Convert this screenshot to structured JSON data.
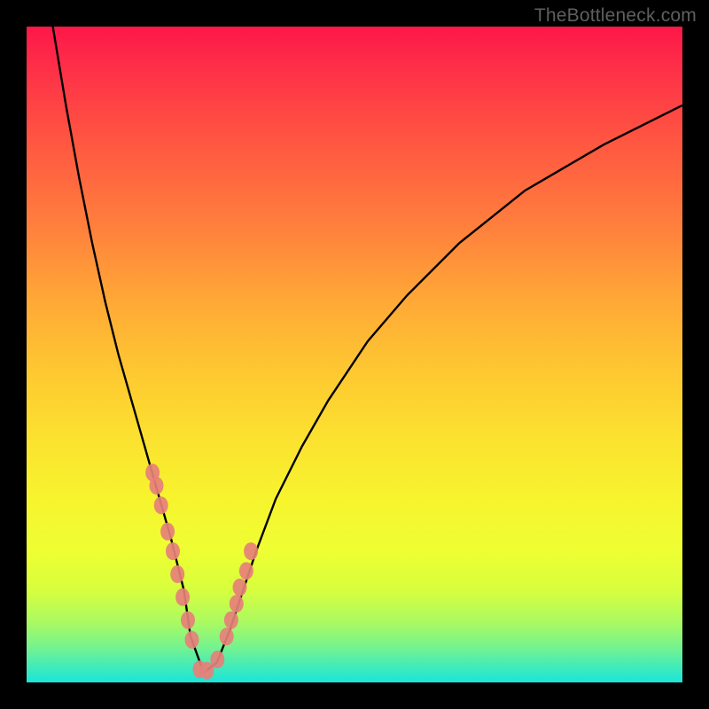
{
  "watermark": "TheBottleneck.com",
  "chart_data": {
    "type": "line",
    "title": "",
    "xlabel": "",
    "ylabel": "",
    "xlim": [
      0,
      100
    ],
    "ylim": [
      0,
      100
    ],
    "gradient_colors": {
      "top": "#fd1748",
      "bottom": "#1ae5d9"
    },
    "curve_description": "V-shaped bottleneck curve with minimum near x=27",
    "series": [
      {
        "name": "bottleneck-curve",
        "x": [
          4,
          6,
          8,
          10,
          12,
          14,
          16,
          18,
          20,
          22,
          24,
          25,
          27,
          29,
          31,
          33,
          35,
          38,
          42,
          46,
          52,
          58,
          66,
          76,
          88,
          100
        ],
        "y": [
          100,
          88,
          77,
          67,
          58,
          50,
          43,
          36,
          29,
          22,
          14,
          7,
          1.5,
          3,
          8,
          14,
          20,
          28,
          36,
          43,
          52,
          59,
          67,
          75,
          82,
          88
        ]
      }
    ],
    "markers": {
      "name": "highlight-points",
      "color": "#e68079",
      "x": [
        19.2,
        19.8,
        20.5,
        21.5,
        22.3,
        23.0,
        23.8,
        24.6,
        25.2,
        26.4,
        27.5,
        29.1,
        30.5,
        31.2,
        32.0,
        32.5,
        33.5,
        34.2
      ],
      "y": [
        32,
        30,
        27,
        23,
        20,
        16.5,
        13,
        9.5,
        6.5,
        2,
        1.8,
        3.5,
        7,
        9.5,
        12,
        14.5,
        17,
        20
      ]
    }
  }
}
